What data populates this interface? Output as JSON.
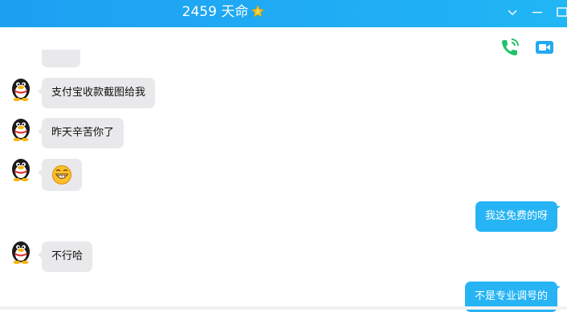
{
  "header": {
    "title": "2459 天命",
    "badge_icon": "gold-star-badge-icon",
    "window_controls": [
      "chevron-down-icon",
      "minimize-icon",
      "maximize-icon"
    ],
    "accent": "#1e9ff2"
  },
  "toolbar": {
    "voice_call_icon": "phone-call-icon",
    "video_call_icon": "video-call-icon"
  },
  "messages": [
    {
      "side": "left",
      "text": "支付宝收款截图给我"
    },
    {
      "side": "left",
      "text": "昨天辛苦你了"
    },
    {
      "side": "left",
      "emoji": "grin-emoji-icon"
    },
    {
      "side": "right",
      "text": "我这免费的呀"
    },
    {
      "side": "left",
      "text": "不行哈"
    },
    {
      "side": "right",
      "text": "不是专业调号的"
    }
  ],
  "colors": {
    "incoming_bubble": "#e9e9eb",
    "outgoing_bubble": "#26b4f5"
  }
}
